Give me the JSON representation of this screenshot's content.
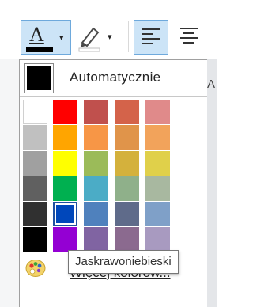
{
  "toolbar": {
    "font_color_glyph": "A",
    "font_color_icon": "font-color-icon",
    "highlight_icon": "highlighter-icon",
    "align_left_icon": "align-left-icon",
    "align_center_icon": "align-center-icon",
    "current_font_color": "#000000"
  },
  "panel": {
    "automatic_label": "Automatycznie",
    "automatic_color": "#000000",
    "more_colors_label": "Więcej kolorów...",
    "more_colors_icon": "color-palette-icon",
    "palette_columns": [
      [
        "#ffffff",
        "#c0c0c0",
        "#a0a0a0",
        "#606060",
        "#303030",
        "#000000"
      ],
      [
        "#ff0000",
        "#ffa500",
        "#ffff00",
        "#00b050",
        "#0047bb",
        "#9400d3"
      ],
      [
        "#c0504d",
        "#f79646",
        "#9bbb59",
        "#4bacc6",
        "#4f81bd",
        "#8064a2"
      ],
      [
        "#d4634a",
        "#e0944a",
        "#d4b13c",
        "#8fb08a",
        "#5f6b8a",
        "#8b6a8f"
      ],
      [
        "#e08a8a",
        "#f2a35b",
        "#e0d04a",
        "#a8b8a0",
        "#7fa0c8",
        "#a89ac0"
      ]
    ],
    "selected_swatch": "#0047bb"
  },
  "tooltip": {
    "text": "Jaskrawoniebieski"
  },
  "background": {
    "edge_letter": "A"
  }
}
